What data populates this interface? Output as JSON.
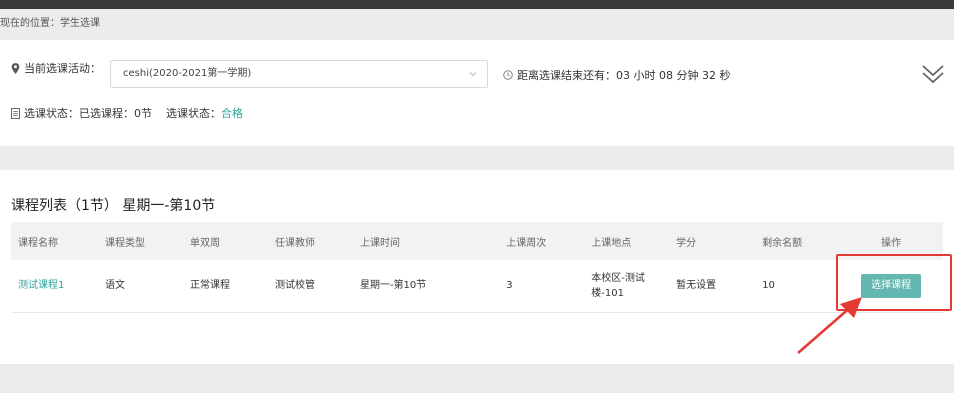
{
  "breadcrumb": "现在的位置：学生选课",
  "activity": {
    "label": "当前选课活动：",
    "selected": "ceshi(2020-2021第一学期)"
  },
  "countdown": "距离选课结束还有：03 小时 08 分钟 32 秒",
  "status": {
    "label": "选课状态：已选课程：0节",
    "status_label": "选课状态：",
    "status_value": "合格"
  },
  "course_list": {
    "title": "课程列表（1节） 星期一-第10节",
    "headers": [
      "课程名称",
      "课程类型",
      "单双周",
      "任课教师",
      "上课时间",
      "上课周次",
      "上课地点",
      "学分",
      "剩余名额",
      "操作"
    ],
    "rows": [
      {
        "name": "测试课程1",
        "type": "语文",
        "week_type": "正常课程",
        "teacher": "测试校管",
        "time": "星期一-第10节",
        "weeks": "3",
        "location": "本校区-测试楼-101",
        "credit": "暂无设置",
        "remaining": "10",
        "action": "选择课程"
      }
    ]
  },
  "colors": {
    "accent": "#2fa39b",
    "button": "#64b7b1",
    "highlight": "#e53935"
  }
}
